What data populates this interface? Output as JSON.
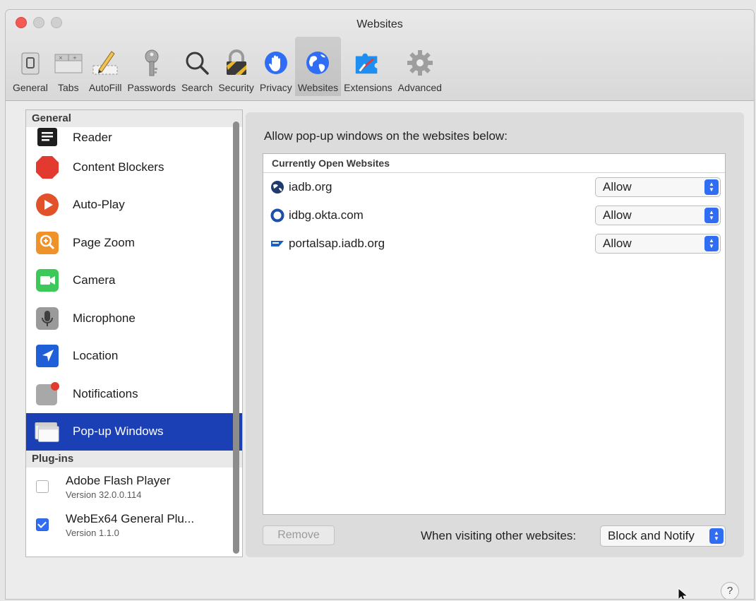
{
  "window": {
    "title": "Websites"
  },
  "toolbar": {
    "items": [
      {
        "label": "General",
        "icon": "general-icon"
      },
      {
        "label": "Tabs",
        "icon": "tabs-icon"
      },
      {
        "label": "AutoFill",
        "icon": "autofill-icon"
      },
      {
        "label": "Passwords",
        "icon": "key-icon"
      },
      {
        "label": "Search",
        "icon": "search-icon"
      },
      {
        "label": "Security",
        "icon": "lock-icon"
      },
      {
        "label": "Privacy",
        "icon": "hand-icon"
      },
      {
        "label": "Websites",
        "icon": "globe-icon",
        "active": true
      },
      {
        "label": "Extensions",
        "icon": "puzzle-icon"
      },
      {
        "label": "Advanced",
        "icon": "gear-icon"
      }
    ]
  },
  "sidebar": {
    "general_header": "General",
    "items": [
      {
        "label": "Reader",
        "icon": "reader-icon"
      },
      {
        "label": "Content Blockers",
        "icon": "stop-icon"
      },
      {
        "label": "Auto-Play",
        "icon": "play-icon"
      },
      {
        "label": "Page Zoom",
        "icon": "zoom-icon"
      },
      {
        "label": "Camera",
        "icon": "camera-icon"
      },
      {
        "label": "Microphone",
        "icon": "microphone-icon"
      },
      {
        "label": "Location",
        "icon": "location-icon"
      },
      {
        "label": "Notifications",
        "icon": "notifications-icon"
      },
      {
        "label": "Pop-up Windows",
        "icon": "popup-windows-icon",
        "selected": true
      }
    ],
    "plugins_header": "Plug-ins",
    "plugins": [
      {
        "name": "Adobe Flash Player",
        "version": "Version 32.0.0.114",
        "enabled": false
      },
      {
        "name": "WebEx64 General Plu...",
        "version": "Version 1.1.0",
        "enabled": true
      }
    ]
  },
  "main": {
    "heading": "Allow pop-up windows on the websites below:",
    "table_header": "Currently Open Websites",
    "sites": [
      {
        "domain": "iadb.org",
        "setting": "Allow",
        "icon": "iadb-favicon"
      },
      {
        "domain": "idbg.okta.com",
        "setting": "Allow",
        "icon": "okta-favicon"
      },
      {
        "domain": "portalsap.iadb.org",
        "setting": "Allow",
        "icon": "sap-favicon"
      }
    ],
    "remove_label": "Remove",
    "other_label": "When visiting other websites:",
    "other_setting": "Block and Notify",
    "help_label": "?"
  },
  "colors": {
    "accent": "#2f6ef4",
    "selection": "#1b3fb5",
    "close": "#f35a55"
  }
}
